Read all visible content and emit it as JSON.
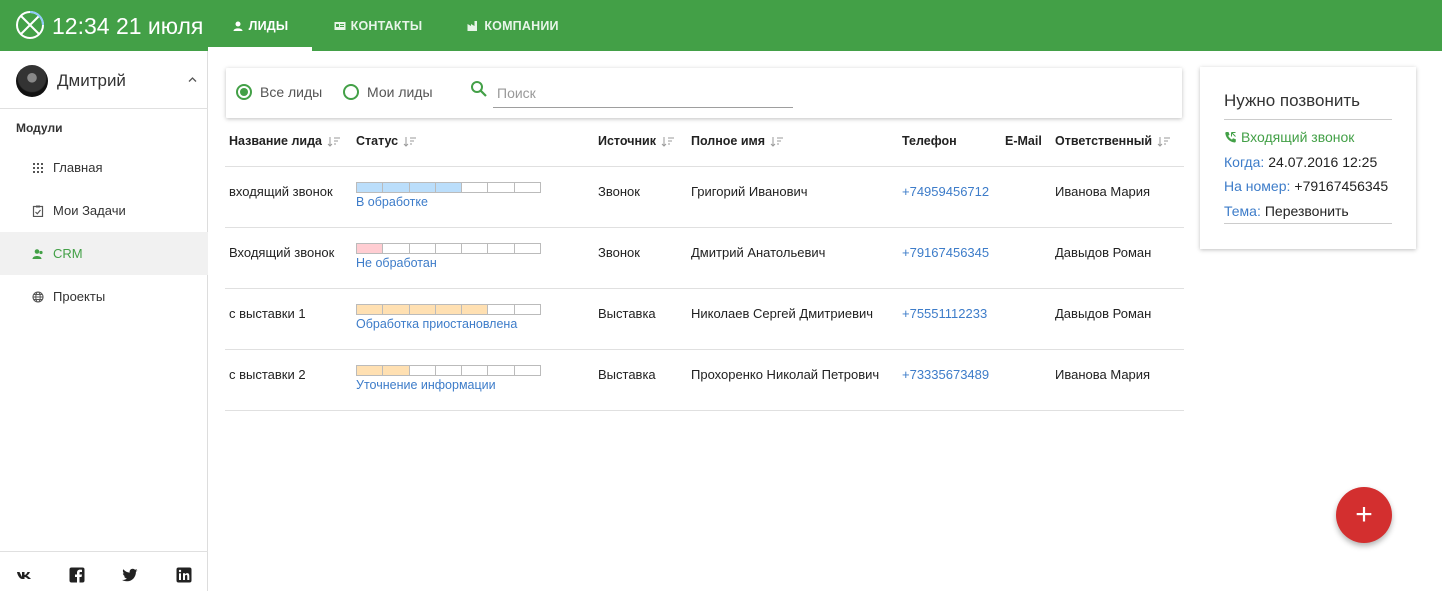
{
  "header": {
    "clock": "12:34 21 июля",
    "tabs": [
      {
        "label": "ЛИДЫ",
        "active": true
      },
      {
        "label": "КОНТАКТЫ",
        "active": false
      },
      {
        "label": "КОМПАНИИ",
        "active": false
      }
    ],
    "colors": {
      "brand": "#43a047",
      "link": "#3d7cc9",
      "fab": "#d32f2f"
    }
  },
  "sidebar": {
    "user_name": "Дмитрий",
    "section_label": "Модули",
    "items": [
      {
        "label": "Главная",
        "icon": "grid-icon",
        "active": false
      },
      {
        "label": "Мои Задачи",
        "icon": "clipboard-icon",
        "active": false
      },
      {
        "label": "CRM",
        "icon": "users-icon",
        "active": true
      },
      {
        "label": "Проекты",
        "icon": "globe-icon",
        "active": false
      }
    ],
    "social": [
      "vk-icon",
      "facebook-icon",
      "twitter-icon",
      "linkedin-icon"
    ]
  },
  "filter": {
    "options": [
      {
        "label": "Все лиды",
        "selected": true
      },
      {
        "label": "Мои лиды",
        "selected": false
      }
    ],
    "search_placeholder": "Поиск",
    "search_value": ""
  },
  "table": {
    "columns": [
      "Название лида",
      "Статус",
      "Источник",
      "Полное имя",
      "Телефон",
      "E-Mail",
      "Ответственный"
    ],
    "rows": [
      {
        "name": "входящий звонок",
        "status": "В обработке",
        "progress": 4,
        "progress_total": 7,
        "progress_color": "#bbdefb",
        "source": "Звонок",
        "full_name": "Григорий Иванович",
        "phone": "+74959456712",
        "email": "",
        "owner": "Иванова Мария"
      },
      {
        "name": "Входящий звонок",
        "status": "Не обработан",
        "progress": 1,
        "progress_total": 7,
        "progress_color": "#ffcdd2",
        "source": "Звонок",
        "full_name": "Дмитрий Анатольевич",
        "phone": "+79167456345",
        "email": "",
        "owner": "Давыдов Роман"
      },
      {
        "name": "с выставки 1",
        "status": "Обработка приостановлена",
        "progress": 5,
        "progress_total": 7,
        "progress_color": "#ffe0b2",
        "source": "Выставка",
        "full_name": "Николаев Сергей Дмитриевич",
        "phone": "+75551112233",
        "email": "",
        "owner": "Давыдов Роман"
      },
      {
        "name": "с выставки 2",
        "status": "Уточнение информации",
        "progress": 2,
        "progress_total": 7,
        "progress_color": "#ffe0b2",
        "source": "Выставка",
        "full_name": "Прохоренко Николай Петрович",
        "phone": "+73335673489",
        "email": "",
        "owner": "Иванова Мария"
      }
    ]
  },
  "call_card": {
    "title": "Нужно позвонить",
    "call_type": "Входящий звонок",
    "when_label": "Когда:",
    "when_value": "24.07.2016 12:25",
    "number_label": "На номер:",
    "number_value": "+79167456345",
    "topic_label": "Тема:",
    "topic_value": "Перезвонить"
  },
  "fab": {
    "label": "+"
  }
}
